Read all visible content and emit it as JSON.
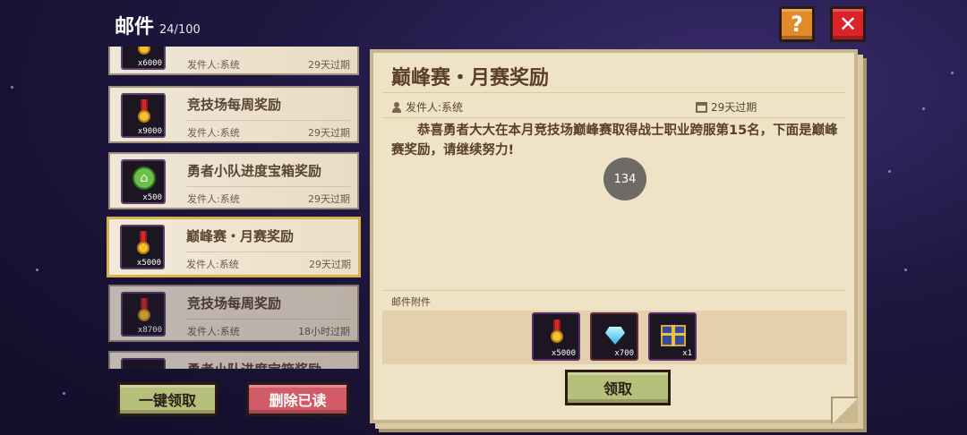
{
  "header": {
    "title": "邮件",
    "count": "24/100"
  },
  "top_buttons": {
    "help": "?",
    "close": "✕"
  },
  "mail_list": [
    {
      "title": "",
      "sender": "发件人:系统",
      "expire": "29天过期",
      "icon": "medal-icon",
      "qty": "x6000"
    },
    {
      "title": "竞技场每周奖励",
      "sender": "发件人:系统",
      "expire": "29天过期",
      "icon": "medal-icon",
      "qty": "x9000"
    },
    {
      "title": "勇者小队进度宝箱奖励",
      "sender": "发件人:系统",
      "expire": "29天过期",
      "icon": "house-icon",
      "qty": "x500"
    },
    {
      "title": "巅峰赛・月赛奖励",
      "sender": "发件人:系统",
      "expire": "29天过期",
      "icon": "medal-icon",
      "qty": "x5000",
      "selected": true
    },
    {
      "title": "竞技场每周奖励",
      "sender": "发件人:系统",
      "expire": "18小时过期",
      "icon": "medal-icon",
      "qty": "x8700"
    },
    {
      "title": "勇者小队进度宝箱奖励",
      "sender": "",
      "expire": "",
      "icon": "",
      "qty": ""
    }
  ],
  "actions": {
    "claim_all": "一键领取",
    "delete_read": "删除已读"
  },
  "detail": {
    "title": "巅峰赛・月赛奖励",
    "sender": "发件人:系统",
    "expire": "29天过期",
    "body": "恭喜勇者大大在本月竞技场巅峰赛取得战士职业跨服第15名，下面是巅峰赛奖励，请继续努力!",
    "page_badge": "134",
    "attachments_label": "邮件附件",
    "attachments": [
      {
        "icon": "medal-icon",
        "qty": "x5000"
      },
      {
        "icon": "diamond-icon",
        "qty": "x700"
      },
      {
        "icon": "chest-icon",
        "qty": "x1"
      }
    ],
    "claim_label": "领取"
  },
  "colors": {
    "accent_gold": "#d8b24a",
    "claim_green": "#b6c07a",
    "delete_red": "#d15b67",
    "close_red": "#d8252a",
    "help_orange": "#e08a2a"
  }
}
